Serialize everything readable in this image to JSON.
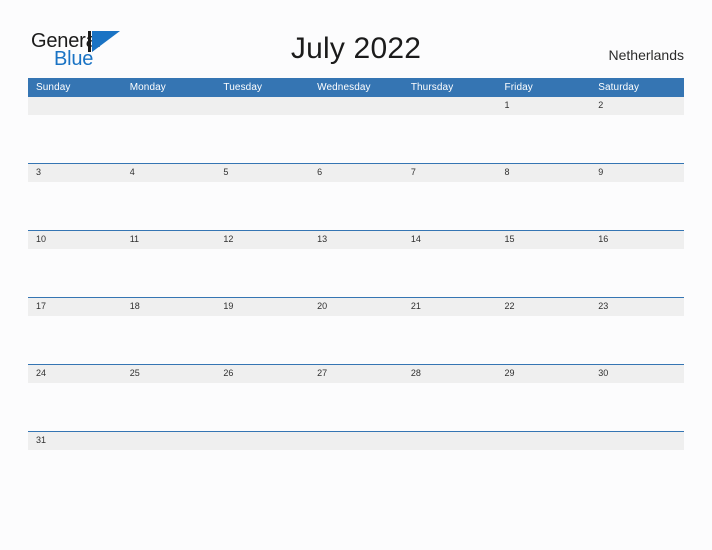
{
  "brand": {
    "name_part1": "General",
    "name_part2": "Blue",
    "mark_icon": "triangle-flag-icon",
    "colors": {
      "dark": "#1b1b1b",
      "blue": "#1a73c4"
    }
  },
  "header": {
    "title": "July 2022",
    "country": "Netherlands"
  },
  "calendar": {
    "month": "July",
    "year": "2022",
    "accent_color": "#3575b3",
    "band_color": "#efefef",
    "weekday_headers": [
      "Sunday",
      "Monday",
      "Tuesday",
      "Wednesday",
      "Thursday",
      "Friday",
      "Saturday"
    ],
    "weeks": [
      [
        "",
        "",
        "",
        "",
        "",
        "1",
        "2"
      ],
      [
        "3",
        "4",
        "5",
        "6",
        "7",
        "8",
        "9"
      ],
      [
        "10",
        "11",
        "12",
        "13",
        "14",
        "15",
        "16"
      ],
      [
        "17",
        "18",
        "19",
        "20",
        "21",
        "22",
        "23"
      ],
      [
        "24",
        "25",
        "26",
        "27",
        "28",
        "29",
        "30"
      ],
      [
        "31",
        "",
        "",
        "",
        "",
        "",
        ""
      ]
    ]
  }
}
